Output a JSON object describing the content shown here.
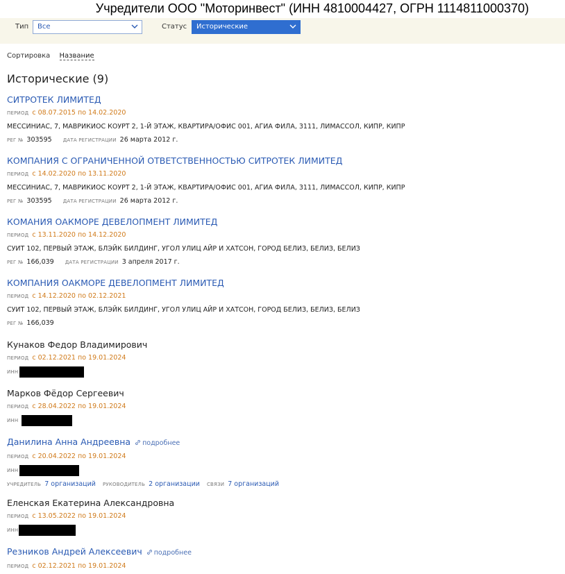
{
  "title": "Учредители ООО \"Моторинвест\" (ИНН 4810004427, ОГРН 1114811000370)",
  "filters": {
    "type_label": "Тип",
    "type_value": "Все",
    "status_label": "Статус",
    "status_value": "Исторические"
  },
  "sort": {
    "label": "Сортировка",
    "value": "Название"
  },
  "section_title": "Исторические (9)",
  "labels": {
    "period": "ПЕРИОД",
    "reg_no": "РЕГ №",
    "reg_date": "ДАТА РЕГИСТРАЦИИ",
    "inn": "ИНН",
    "founder": "УЧРЕДИТЕЛЬ",
    "manager": "РУКОВОДИТЕЛЬ",
    "links": "СВЯЗИ",
    "more": "подробнее"
  },
  "entries": [
    {
      "name": "СИТРОТЕК ЛИМИТЕД",
      "period": "с 08.07.2015 по 14.02.2020",
      "address": "МЕССИНИАС, 7, МАВРИКИОС КОУРТ 2, 1-Й ЭТАЖ, КВАРТИРА/ОФИС 001, АГИА ФИЛА, 3111, ЛИМАССОЛ, КИПР, КИПР",
      "reg_no": "303595",
      "reg_date": "26 марта 2012 г."
    },
    {
      "name": "КОМПАНИЯ С ОГРАНИЧЕННОЙ ОТВЕТСТВЕННОСТЬЮ СИТРОТЕК ЛИМИТЕД",
      "period": "с 14.02.2020 по 13.11.2020",
      "address": "МЕССИНИАС, 7, МАВРИКИОС КОУРТ 2, 1-Й ЭТАЖ, КВАРТИРА/ОФИС 001, АГИА ФИЛА, 3111, ЛИМАССОЛ, КИПР, КИПР",
      "reg_no": "303595",
      "reg_date": "26 марта 2012 г."
    },
    {
      "name": "КОМАНИЯ ОАКМОРЕ ДЕВЕЛОПМЕНТ ЛИМИТЕД",
      "period": "с 13.11.2020 по 14.12.2020",
      "address": "СУИТ 102, ПЕРВЫЙ ЭТАЖ, БЛЭЙК БИЛДИНГ, УГОЛ УЛИЦ АЙР И ХАТСОН, ГОРОД БЕЛИЗ, БЕЛИЗ, БЕЛИЗ",
      "reg_no": "166,039",
      "reg_date": "3 апреля 2017 г."
    },
    {
      "name": "КОМПАНИЯ ОАКМОРЕ ДЕВЕЛОПМЕНТ ЛИМИТЕД",
      "period": "с 14.12.2020 по 02.12.2021",
      "address": "СУИТ 102, ПЕРВЫЙ ЭТАЖ, БЛЭЙК БИЛДИНГ, УГОЛ УЛИЦ АЙР И ХАТСОН, ГОРОД БЕЛИЗ, БЕЛИЗ, БЕЛИЗ",
      "reg_no": "166,039"
    },
    {
      "name": "Кунаков Федор Владимирович",
      "period": "с 02.12.2021 по 19.01.2024"
    },
    {
      "name": "Марков Фёдор Сергеевич",
      "period": "с 28.04.2022 по 19.01.2024"
    },
    {
      "name": "Данилина Анна Андреевна",
      "period": "с 20.04.2022 по 19.01.2024",
      "founder_count": "7 организаций",
      "manager_count": "2 организации",
      "links_count": "7 организаций"
    },
    {
      "name": "Еленская Екатерина Александровна",
      "period": "с 13.05.2022 по 19.01.2024"
    },
    {
      "name": "Резников Андрей Алексеевич",
      "period": "с 02.12.2021 по 19.01.2024"
    }
  ]
}
